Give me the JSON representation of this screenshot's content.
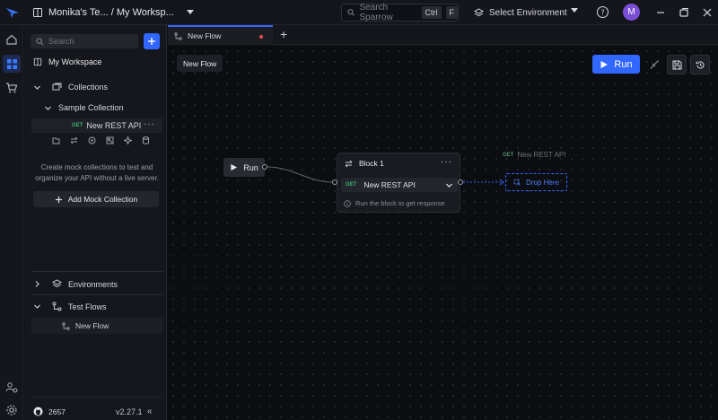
{
  "titlebar": {
    "workspace_switcher": "Monika's Te... / My Worksp...",
    "search_placeholder": "Search Sparrow",
    "search_shortcut_key1": "Ctrl",
    "search_shortcut_key2": "F",
    "environment_select": "Select Environment",
    "avatar_initial": "M"
  },
  "sidebar": {
    "search_placeholder": "Search",
    "workspace_title": "My Workspace",
    "collections_label": "Collections",
    "collection_name": "Sample Collection",
    "request": {
      "method": "GET",
      "name": "New REST API"
    },
    "mock_text": "Create mock collections to test and organize your API without a live server.",
    "add_mock_button": "Add Mock Collection",
    "environments_label": "Environments",
    "test_flows_label": "Test Flows",
    "flow_item": "New Flow",
    "github_stars": "2657",
    "version": "v2.27.1"
  },
  "tabs": [
    {
      "label": "New Flow",
      "unsaved": true
    }
  ],
  "canvas": {
    "flow_name": "New Flow",
    "run_button": "Run",
    "run_node_label": "Run",
    "block": {
      "title": "Block 1",
      "request_method": "GET",
      "request_name": "New REST API",
      "hint": "Run the block to get response"
    },
    "ghost_request": {
      "method": "GET",
      "name": "New REST API"
    },
    "drop_zone": "Drop Here"
  },
  "colors": {
    "accent": "#3167ff",
    "method_get": "#38b36b",
    "unsaved_dot": "#e34b4b",
    "avatar": "#7a4fd6"
  }
}
